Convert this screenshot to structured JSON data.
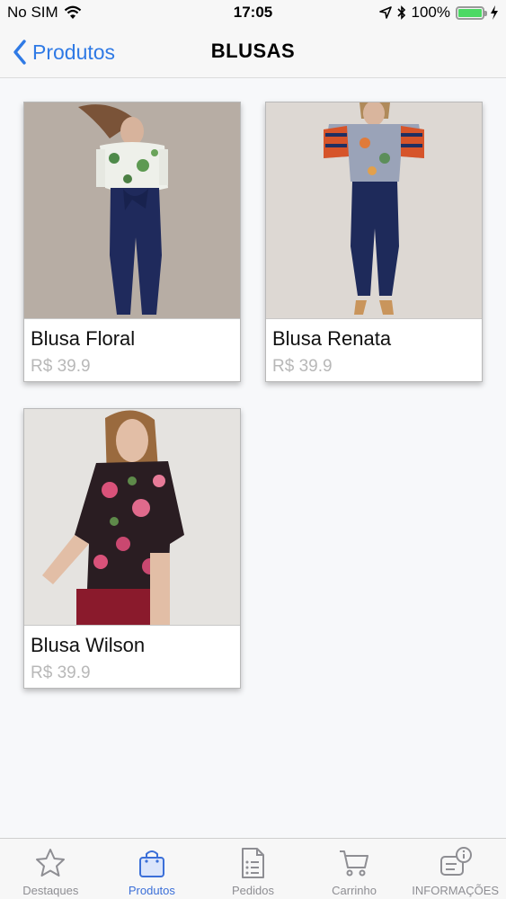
{
  "status_bar": {
    "carrier": "No SIM",
    "time": "17:05",
    "battery": "100%",
    "wifi_icon": "wifi-icon",
    "location_icon": "location-arrow-icon",
    "bluetooth_icon": "bluetooth-icon",
    "battery_icon": "battery-icon",
    "charging_icon": "charging-bolt-icon"
  },
  "nav": {
    "back_label": "Produtos",
    "title": "BLUSAS"
  },
  "products": [
    {
      "name": "Blusa Floral",
      "price": "R$ 39.9",
      "image": "photo of woman in floral off-shoulder blouse and navy pants"
    },
    {
      "name": "Blusa Renata",
      "price": "R$ 39.9",
      "image": "photo of woman in striped floral blouse and navy pants"
    },
    {
      "name": "Blusa Wilson",
      "price": "R$ 39.9",
      "image": "photo of woman in black floral blouse and red pants"
    }
  ],
  "tabs": [
    {
      "label": "Destaques",
      "icon": "star-icon",
      "active": false
    },
    {
      "label": "Produtos",
      "icon": "shopping-bag-icon",
      "active": true
    },
    {
      "label": "Pedidos",
      "icon": "document-list-icon",
      "active": false
    },
    {
      "label": "Carrinho",
      "icon": "cart-icon",
      "active": false
    },
    {
      "label": "INFORMAÇÕES",
      "icon": "info-message-icon",
      "active": false
    }
  ],
  "colors": {
    "accent": "#2f7ae5",
    "tab_active": "#3b6fd8",
    "tab_inactive": "#8e8e93",
    "price": "#b8b8b8",
    "battery_fill": "#4cd964"
  }
}
